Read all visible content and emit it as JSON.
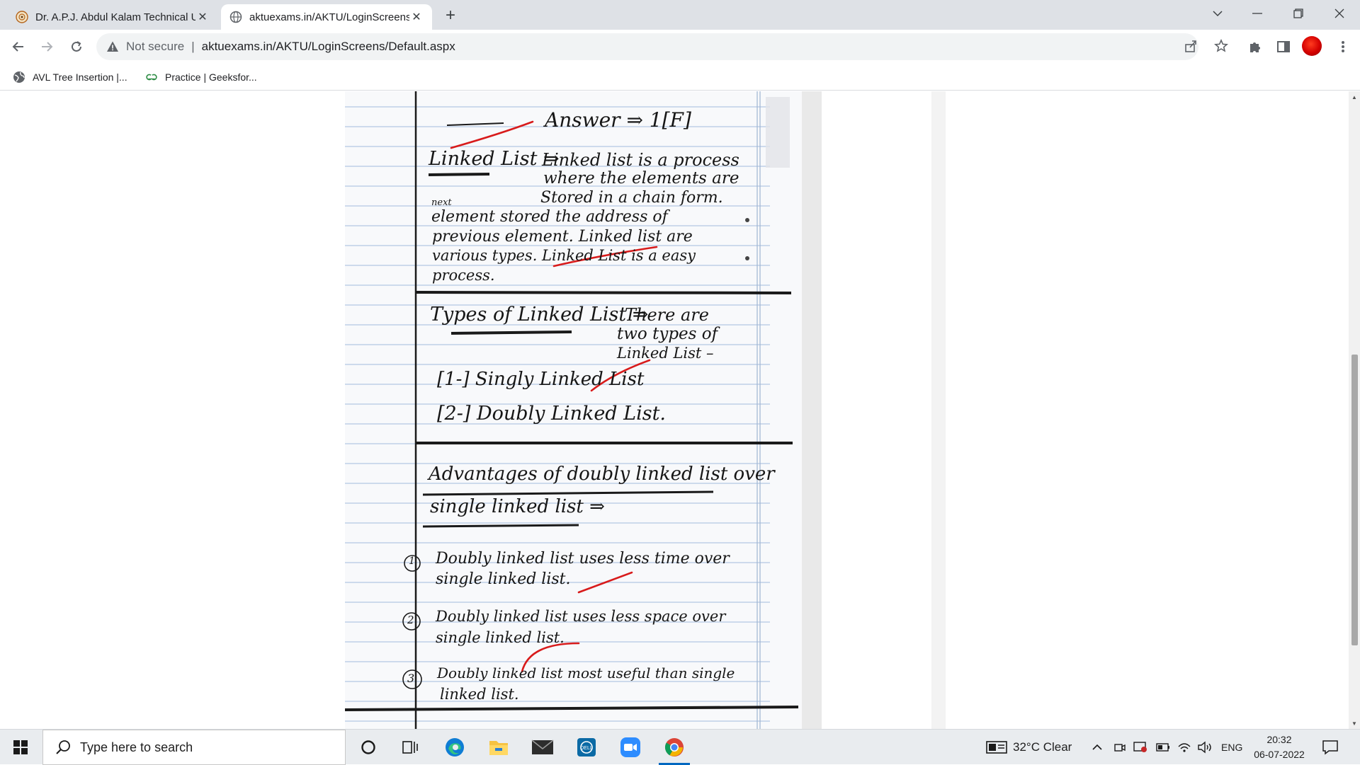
{
  "browser": {
    "tabs": [
      {
        "title": "Dr. A.P.J. Abdul Kalam Technical U",
        "active": false
      },
      {
        "title": "aktuexams.in/AKTU/LoginScreens",
        "active": true
      }
    ],
    "security_label": "Not secure",
    "url": "aktuexams.in/AKTU/LoginScreens/Default.aspx",
    "bookmarks": [
      {
        "label": "AVL Tree Insertion |...",
        "icon": "globe-icon"
      },
      {
        "label": "Practice | Geeksfor...",
        "icon": "geeksforgeeks-icon"
      }
    ],
    "accent_color": "#1a73e8"
  },
  "answer_sheet": {
    "heading": "Answer ⇒ 1[F]",
    "sections": [
      {
        "title": "Linked List ⇒",
        "lines": [
          "Linked list is a process",
          "where the elements are",
          "Stored in a chain form.",
          "next",
          "element stored the address of",
          "previous element. Linked list are",
          "various types. Linked List is a easy",
          "process."
        ]
      },
      {
        "title": "Types of Linked List ⇒",
        "lines": [
          "There are",
          "two types of",
          "Linked List –",
          "[1-] Singly Linked List",
          "[2-] Doubly Linked List."
        ]
      },
      {
        "title": "Advantages of doubly linked list over",
        "lines": [
          "single linked list ⇒"
        ]
      }
    ],
    "points": [
      {
        "marker": "1",
        "lines": [
          "Doubly linked list uses less time over",
          "single linked list."
        ]
      },
      {
        "marker": "2",
        "lines": [
          "Doubly linked list uses less space over",
          "single linked list."
        ]
      },
      {
        "marker": "3",
        "lines": [
          "Doubly linked list most useful than single",
          "linked list."
        ]
      }
    ],
    "ink_color": "#161616",
    "mark_color": "#d81b1b"
  },
  "taskbar": {
    "search_placeholder": "Type here to search",
    "apps": [
      "cortana-icon",
      "task-view-icon",
      "edge-icon",
      "file-explorer-icon",
      "mail-icon",
      "dell-icon",
      "zoom-icon",
      "chrome-icon"
    ],
    "weather": "32°C  Clear",
    "language": "ENG",
    "time": "20:32",
    "date": "06-07-2022"
  }
}
